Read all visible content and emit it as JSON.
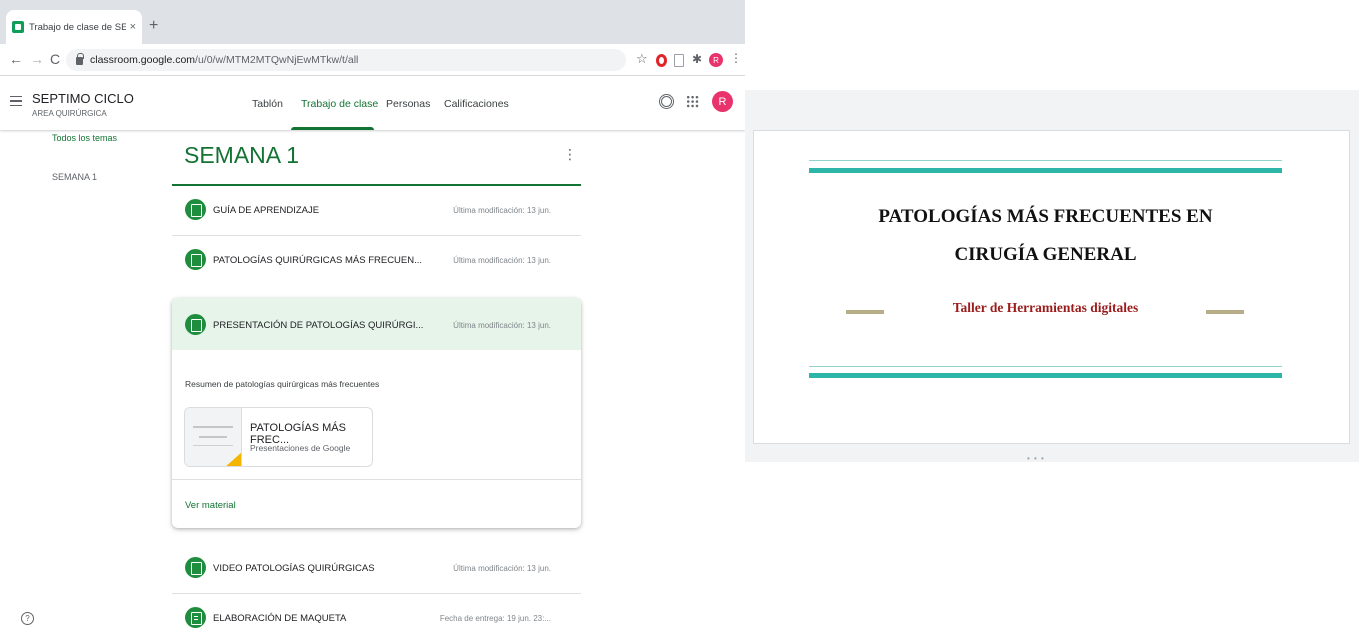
{
  "browser": {
    "tab_title": "Trabajo de clase de SEPTIMO",
    "tab_close": "×",
    "new_tab": "+",
    "url_host": "classroom.google.com",
    "url_path": "/u/0/w/MTM2MTQwNjEwMTkw/t/all",
    "back": "←",
    "forward": "→",
    "reload": "C",
    "star": "☆",
    "puzzle": "✱",
    "profile_letter": "R",
    "menu": "⋮"
  },
  "app": {
    "class_name": "SEPTIMO CICLO",
    "class_section": "AREA QUIRÚRGICA",
    "tabs": [
      "Tablón",
      "Trabajo de clase",
      "Personas",
      "Calificaciones"
    ],
    "active_tab": "Trabajo de clase",
    "avatar_letter": "R",
    "help": "?"
  },
  "sidebar": {
    "items": [
      "Todos los temas",
      "SEMANA 1"
    ]
  },
  "topic": {
    "title": "SEMANA 1",
    "menu": "⋮",
    "items": [
      {
        "title": "GUÍA DE APRENDIZAJE",
        "meta": "Última modificación: 13 jun."
      },
      {
        "title": "PATOLOGÍAS QUIRÚRGICAS MÁS FRECUEN...",
        "meta": "Última modificación: 13 jun."
      },
      {
        "title": "PRESENTACIÓN DE PATOLOGÍAS QUIRÚRGI...",
        "meta": "Última modificación: 13 jun."
      },
      {
        "title": "VIDEO PATOLOGÍAS QUIRÚRGICAS",
        "meta": "Última modificación: 13 jun."
      },
      {
        "title": "ELABORACIÓN DE MAQUETA",
        "meta": "Fecha de entrega: 19 jun. 23:..."
      }
    ],
    "expanded": {
      "description": "Resumen de patologías quirúrgicas más frecuentes",
      "attachment_title": "PATOLOGÍAS MÁS FREC...",
      "attachment_type": "Presentaciones de Google",
      "link": "Ver material"
    }
  },
  "slide": {
    "title_line1": "PATOLOGÍAS MÁS FRECUENTES EN",
    "title_line2": "CIRUGÍA GENERAL",
    "subtitle": "Taller  de Herramientas digitales",
    "dots": "• • •"
  },
  "colors": {
    "classroom_green": "#137333",
    "icon_green": "#1e8e3e",
    "highlight": "#e6f4ea",
    "teal": "#2cb5a8",
    "gold": "#b8ad89",
    "subtitle_red": "#9b1c1c",
    "avatar_pink": "#e8336d"
  }
}
